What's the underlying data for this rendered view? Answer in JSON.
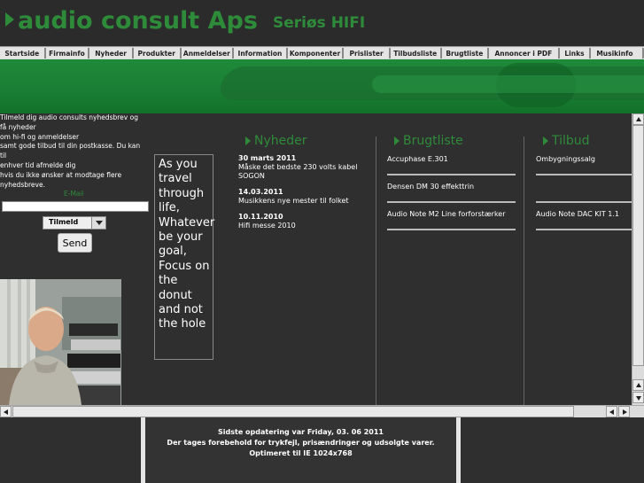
{
  "header": {
    "logo_text": "audio consult Aps",
    "tagline": "Seriøs HIFI",
    "brand_color": "#2e8b3a"
  },
  "nav": {
    "items": [
      "Startside",
      "Firmainfo",
      "Nyheder",
      "Produkter",
      "Anmeldelser",
      "Information",
      "Komponenter",
      "Prislister",
      "Tilbudsliste",
      "Brugtliste",
      "Annoncer i PDF",
      "Links",
      "Musikinfo"
    ]
  },
  "newsletter": {
    "intro": "Tilmeld dig audio consults nyhedsbrev og få nyheder om hi-fi og anmeldelser samt gode tilbud til din postkasse. Du kan til enhver tid afmelde dig hvis du ikke ønsker at modtage flere nyhedsbreve.",
    "lines": [
      "Tilmeld dig audio consults nyhedsbrev og",
      "få nyheder",
      "om hi-fi og anmeldelser",
      "samt gode tilbud til din postkasse. Du kan",
      "til",
      "enhver tid afmelde dig",
      "hvis du ikke ønsker at modtage flere",
      "nyhedsbreve."
    ],
    "email_label": "E-Mail",
    "email_value": "",
    "select_value": "Tilmeld",
    "send_label": "Send"
  },
  "quote": {
    "text": "As you travel through life, Whatever be your goal, Focus on the donut and not the hole",
    "lines": [
      "As you",
      "travel",
      "through",
      "life,",
      "Whatever",
      "be your",
      "goal,",
      "Focus on",
      "the",
      "donut",
      "and not",
      "the hole"
    ]
  },
  "nyheder": {
    "title": "Nyheder",
    "items": [
      {
        "date": "30 marts 2011",
        "text": "Måske det bedste 230 volts kabel SOGON"
      },
      {
        "date": "14.03.2011",
        "text": "Musikkens nye mester til folket"
      },
      {
        "date": "10.11.2010",
        "text": "Hifi messe 2010"
      }
    ]
  },
  "brugtliste": {
    "title": "Brugtliste",
    "items": [
      "Accuphase E.301",
      "Densen DM 30 effekttrin",
      "Audio Note M2 Line forforstærker"
    ]
  },
  "tilbud": {
    "title": "Tilbud",
    "items": [
      "Ombygningssalg",
      "",
      "Audio Note DAC KIT 1.1"
    ]
  },
  "footer": {
    "line1": "Sidste opdatering var Friday, 03. 06 2011",
    "line2": "Der tages forebehold for trykfejl, prisændringer og udsolgte varer.",
    "line3": "Optimeret til IE 1024x768"
  }
}
